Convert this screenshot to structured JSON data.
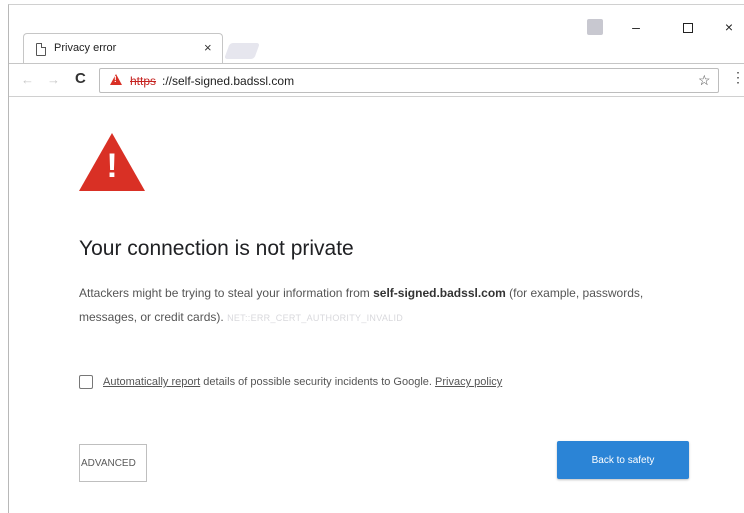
{
  "tab": {
    "title": "Privacy error",
    "close": "×"
  },
  "window_controls": {
    "minimize": "–",
    "close": "×"
  },
  "toolbar": {
    "back": "←",
    "forward": "→",
    "reload": "C",
    "url_scheme": "https",
    "url_rest": "://self-signed.badssl.com",
    "star": "☆",
    "menu": "⋮"
  },
  "page": {
    "warning_bang": "!",
    "heading": "Your connection is not private",
    "para_prefix": "Attackers might be trying to steal your information from ",
    "para_host": "self-signed.badssl.com",
    "para_suffix": " (for example, passwords, messages, or credit cards). ",
    "para_code": "NET::ERR_CERT_AUTHORITY_INVALID",
    "checkbox_link": "Automatically report",
    "checkbox_text": " details of possible security incidents to Google. ",
    "privacy_link": "Privacy policy",
    "advanced_label": "ADVANCED",
    "safety_label": "Back to safety"
  },
  "colors": {
    "warning_red": "#d93025",
    "primary_button": "#2b84d6"
  }
}
